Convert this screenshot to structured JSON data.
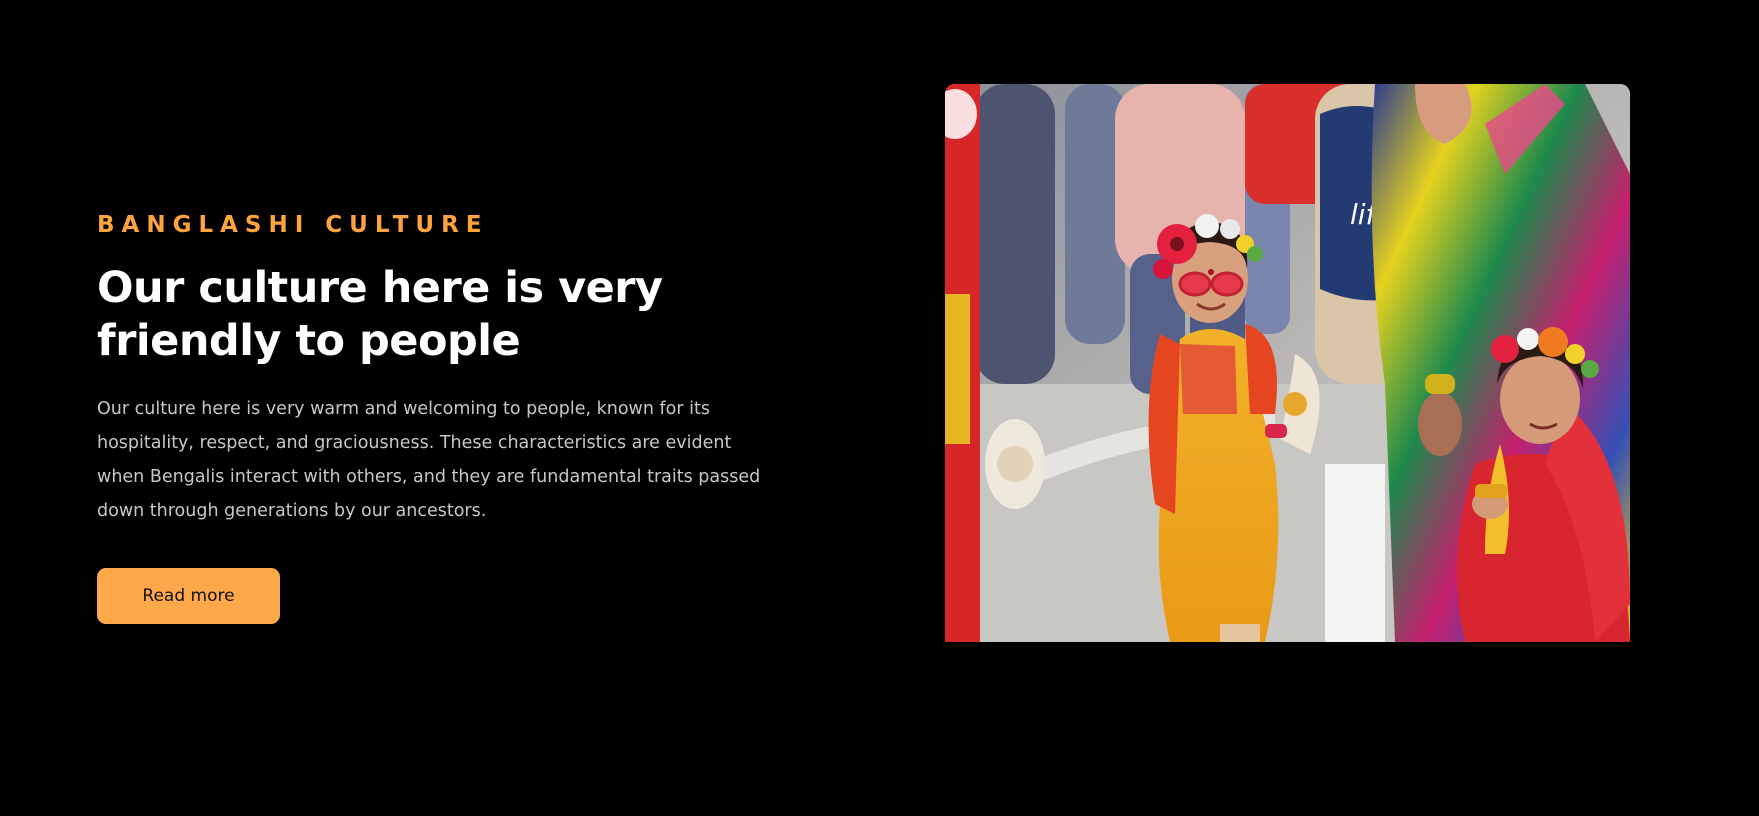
{
  "section": {
    "eyebrow": "BANGLASHI CULTURE",
    "headline": "Our culture here is very friendly to people",
    "body": "Our culture here is very warm and welcoming to people, known for its hospitality, respect, and graciousness. These characteristics are evident when Bengalis interact with others, and they are fundamental traits passed down through generations by our ancestors.",
    "button_label": "Read more"
  },
  "photo": {
    "alt": "Children in colorful traditional dress and flower crowns at a street festival"
  },
  "colors": {
    "background": "#000000",
    "accent": "#FFA33C",
    "button": "#FFA84A",
    "headline": "#FFFFFF",
    "body_text": "#C7C7C7"
  }
}
